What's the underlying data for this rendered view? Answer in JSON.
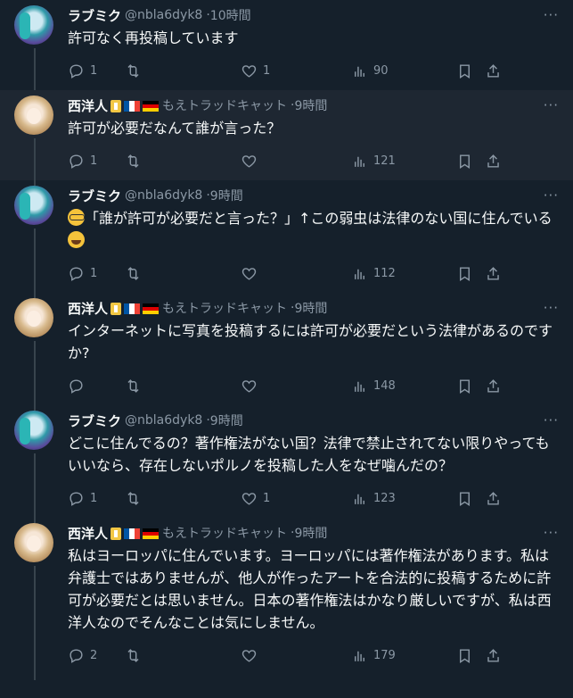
{
  "tweets": [
    {
      "avatar": "miku",
      "name": "ラブミク",
      "handle": "@nbla6dyk8",
      "time": "10時間",
      "text": "許可なく再投稿しています",
      "replies": "1",
      "retweets": "",
      "likes": "1",
      "views": "90",
      "highlight": false,
      "badges": false
    },
    {
      "avatar": "seiyou",
      "name": "西洋人",
      "handle": "もえトラッドキャット",
      "time": "9時間",
      "text": "許可が必要だなんて誰が言った？",
      "replies": "1",
      "retweets": "",
      "likes": "",
      "views": "121",
      "highlight": true,
      "badges": true
    },
    {
      "avatar": "miku",
      "name": "ラブミク",
      "handle": "@nbla6dyk8",
      "time": "9時間",
      "text_before_emoji": "「誰が許可が必要だと言った？」↑この弱虫は法律のない国に住んでいる",
      "text": "",
      "replies": "1",
      "retweets": "",
      "likes": "",
      "views": "112",
      "highlight": false,
      "badges": false
    },
    {
      "avatar": "seiyou",
      "name": "西洋人",
      "handle": "もえトラッドキャット",
      "time": "9時間",
      "text": "インターネットに写真を投稿するには許可が必要だという法律があるのですか?",
      "replies": "",
      "retweets": "",
      "likes": "",
      "views": "148",
      "highlight": false,
      "badges": true
    },
    {
      "avatar": "miku",
      "name": "ラブミク",
      "handle": "@nbla6dyk8",
      "time": "9時間",
      "text": "どこに住んでるの？著作権法がない国？法律で禁止されてない限りやってもいいなら、存在しないポルノを投稿した人をなぜ噛んだの？",
      "replies": "1",
      "retweets": "",
      "likes": "1",
      "views": "123",
      "highlight": false,
      "badges": false
    },
    {
      "avatar": "seiyou",
      "name": "西洋人",
      "handle": "もえトラッドキャット",
      "time": "9時間",
      "text": "私はヨーロッパに住んでいます。ヨーロッパには著作権法があります。私は弁護士ではありませんが、他人が作ったアートを合法的に投稿するために許可が必要だとは思いません。日本の著作権法はかなり厳しいですが、私は西洋人なのでそんなことは気にしません。",
      "replies": "2",
      "retweets": "",
      "likes": "",
      "views": "179",
      "highlight": false,
      "badges": true
    }
  ],
  "colors": {
    "background": "#15202b",
    "highlight_bg": "#1e2732",
    "text": "#f7f9f9",
    "muted": "#8b98a5"
  }
}
